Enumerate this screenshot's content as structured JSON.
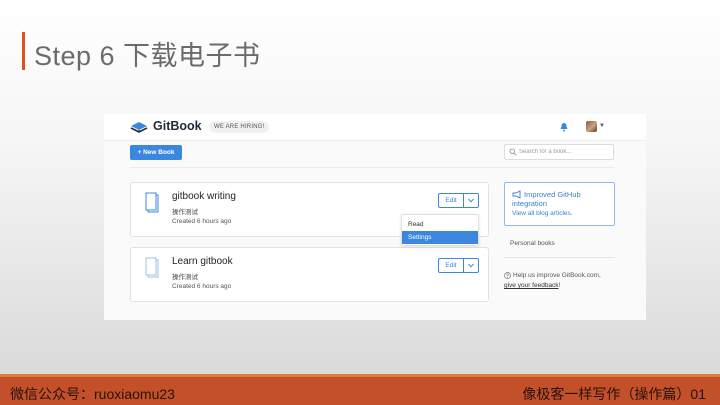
{
  "slide": {
    "title": "Step 6 下载电子书",
    "accent_color": "#d9551f"
  },
  "header": {
    "brand": "GitBook",
    "hiring_badge": "WE ARE HIRING!",
    "icons": [
      "gitbook-logo-icon",
      "notification-bell-icon",
      "user-avatar",
      "chevron-down-icon"
    ]
  },
  "toolbar": {
    "new_book_label": "+ New Book",
    "search_placeholder": "Search for a book..."
  },
  "books": [
    {
      "title": "gitbook writing",
      "description": "操作测试",
      "updated": "Created 6 hours ago",
      "edit_label": "Edit"
    },
    {
      "title": "Learn gitbook",
      "description": "操作测试",
      "updated": "Created 6 hours ago",
      "edit_label": "Edit"
    }
  ],
  "dropdown": {
    "items": [
      "Read",
      "Settings"
    ],
    "selected": "Settings"
  },
  "sidebar": {
    "promo_title": "Improved GitHub integration",
    "promo_link": "View all blog articles.",
    "personal_books": "Personal books",
    "help_text": "Help us improve GitBook.com,",
    "feedback_link": "give your feedback",
    "feedback_suffix": "!"
  },
  "footer": {
    "left": "微信公众号：ruoxiaomu23",
    "right": "像极客一样写作（操作篇）01"
  },
  "colors": {
    "primary": "#3b87e0",
    "footer_bg": "#c2502a"
  }
}
